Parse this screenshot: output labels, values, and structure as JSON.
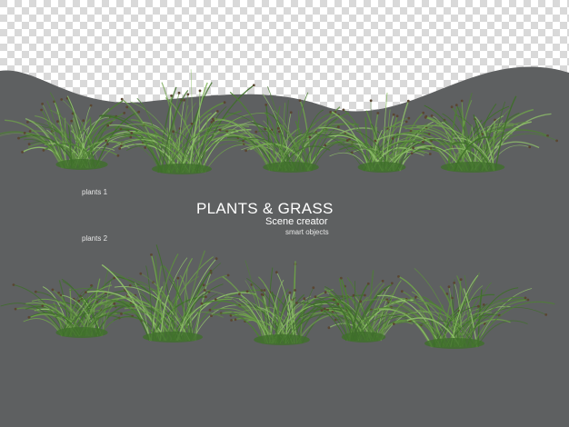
{
  "labels": {
    "row1": "plants 1",
    "row2": "plants 2",
    "title": "PLANTS & GRASS",
    "subtitle": "Scene creator",
    "tagline": "smart objects"
  },
  "colors": {
    "background_gray": "#5e6061",
    "checker_light": "#ffffff",
    "checker_dark": "#d9d9d9",
    "grass_dark": "#3f6f2a",
    "grass_mid": "#5f8f40",
    "grass_light": "#8fbf6a",
    "seedhead": "#5a4632"
  },
  "image": {
    "description_icons": [
      "transparency-checkerboard-icon",
      "grass-clump-icon"
    ]
  }
}
